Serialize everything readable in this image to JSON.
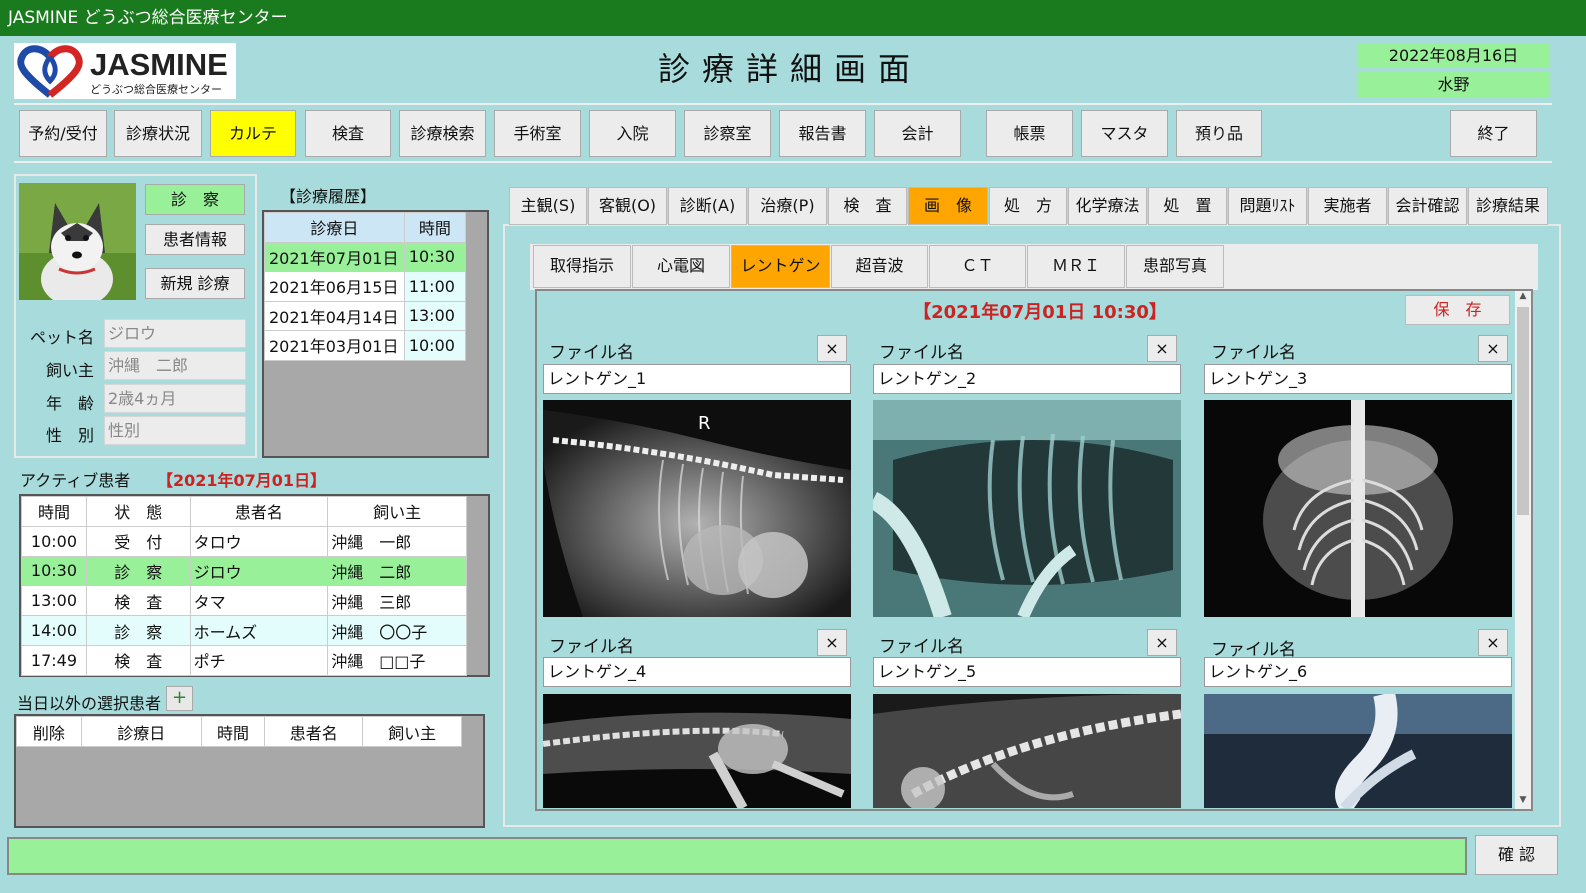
{
  "window": {
    "title": "JASMINE どうぶつ総合医療センター"
  },
  "logo": {
    "brand": "JASMINE",
    "subtitle": "どうぶつ総合医療センター"
  },
  "page_title": "診療詳細画面",
  "header": {
    "date": "2022年08月16日",
    "user": "水野"
  },
  "toolbar": {
    "buttons": [
      "予約/受付",
      "診療状況",
      "カルテ",
      "検査",
      "診療検索",
      "手術室",
      "入院",
      "診察室",
      "報告書",
      "会計",
      "帳票",
      "マスタ",
      "預り品",
      "終了"
    ],
    "active": "カルテ"
  },
  "patient_panel": {
    "buttons": {
      "consult": "診　察",
      "info": "患者情報",
      "new": "新規 診療"
    },
    "labels": {
      "pet": "ペット名",
      "owner": "飼い主",
      "age": "年　齢",
      "sex": "性　別"
    },
    "values": {
      "pet": "ジロウ",
      "owner": "沖縄　二郎",
      "age": "2歳4ヵ月",
      "sex": "性別"
    }
  },
  "history": {
    "title": "【診療履歴】",
    "headers": [
      "診療日",
      "時間"
    ],
    "rows": [
      [
        "2021年07月01日",
        "10:30"
      ],
      [
        "2021年06月15日",
        "11:00"
      ],
      [
        "2021年04月14日",
        "13:00"
      ],
      [
        "2021年03月01日",
        "10:00"
      ]
    ]
  },
  "active_patients": {
    "title": "アクティブ患者",
    "date": "【2021年07月01日】",
    "headers": [
      "時間",
      "状　態",
      "患者名",
      "飼い主"
    ],
    "rows": [
      [
        "10:00",
        "受　付",
        "タロウ",
        "沖縄　一郎"
      ],
      [
        "10:30",
        "診　察",
        "ジロウ",
        "沖縄　二郎"
      ],
      [
        "13:00",
        "検　査",
        "タマ",
        "沖縄　三郎"
      ],
      [
        "14:00",
        "診　察",
        "ホームズ",
        "沖縄　〇〇子"
      ],
      [
        "17:49",
        "検　査",
        "ポチ",
        "沖縄　□□子"
      ]
    ]
  },
  "other_patients": {
    "title": "当日以外の選択患者",
    "add": "+",
    "headers": [
      "削除",
      "診療日",
      "時間",
      "患者名",
      "飼い主"
    ]
  },
  "chart_tabs": {
    "items": [
      "主観(S)",
      "客観(O)",
      "診断(A)",
      "治療(P)",
      "検　査",
      "画　像",
      "処　方",
      "化学療法",
      "処　置",
      "問題ﾘｽﾄ",
      "実施者",
      "会計確認",
      "診療結果"
    ],
    "active": "画　像"
  },
  "image_tabs": {
    "items": [
      "取得指示",
      "心電図",
      "レントゲン",
      "超音波",
      "ＣＴ",
      "ＭＲＩ",
      "患部写真"
    ],
    "active": "レントゲン"
  },
  "image_view": {
    "datetime": "【2021年07月01日 10:30】",
    "save": "保　存",
    "file_label": "ファイル名",
    "close": "×",
    "files": [
      "レントゲン_1",
      "レントゲン_2",
      "レントゲン_3",
      "レントゲン_4",
      "レントゲン_5",
      "レントゲン_6"
    ],
    "marker": "R"
  },
  "footer": {
    "confirm": "確 認"
  },
  "colors": {
    "titlebar": "#197a1e",
    "background": "#a8dcdc",
    "active_tab": "#ffa500",
    "active_nav": "#ffff00",
    "highlight": "#98f098"
  }
}
